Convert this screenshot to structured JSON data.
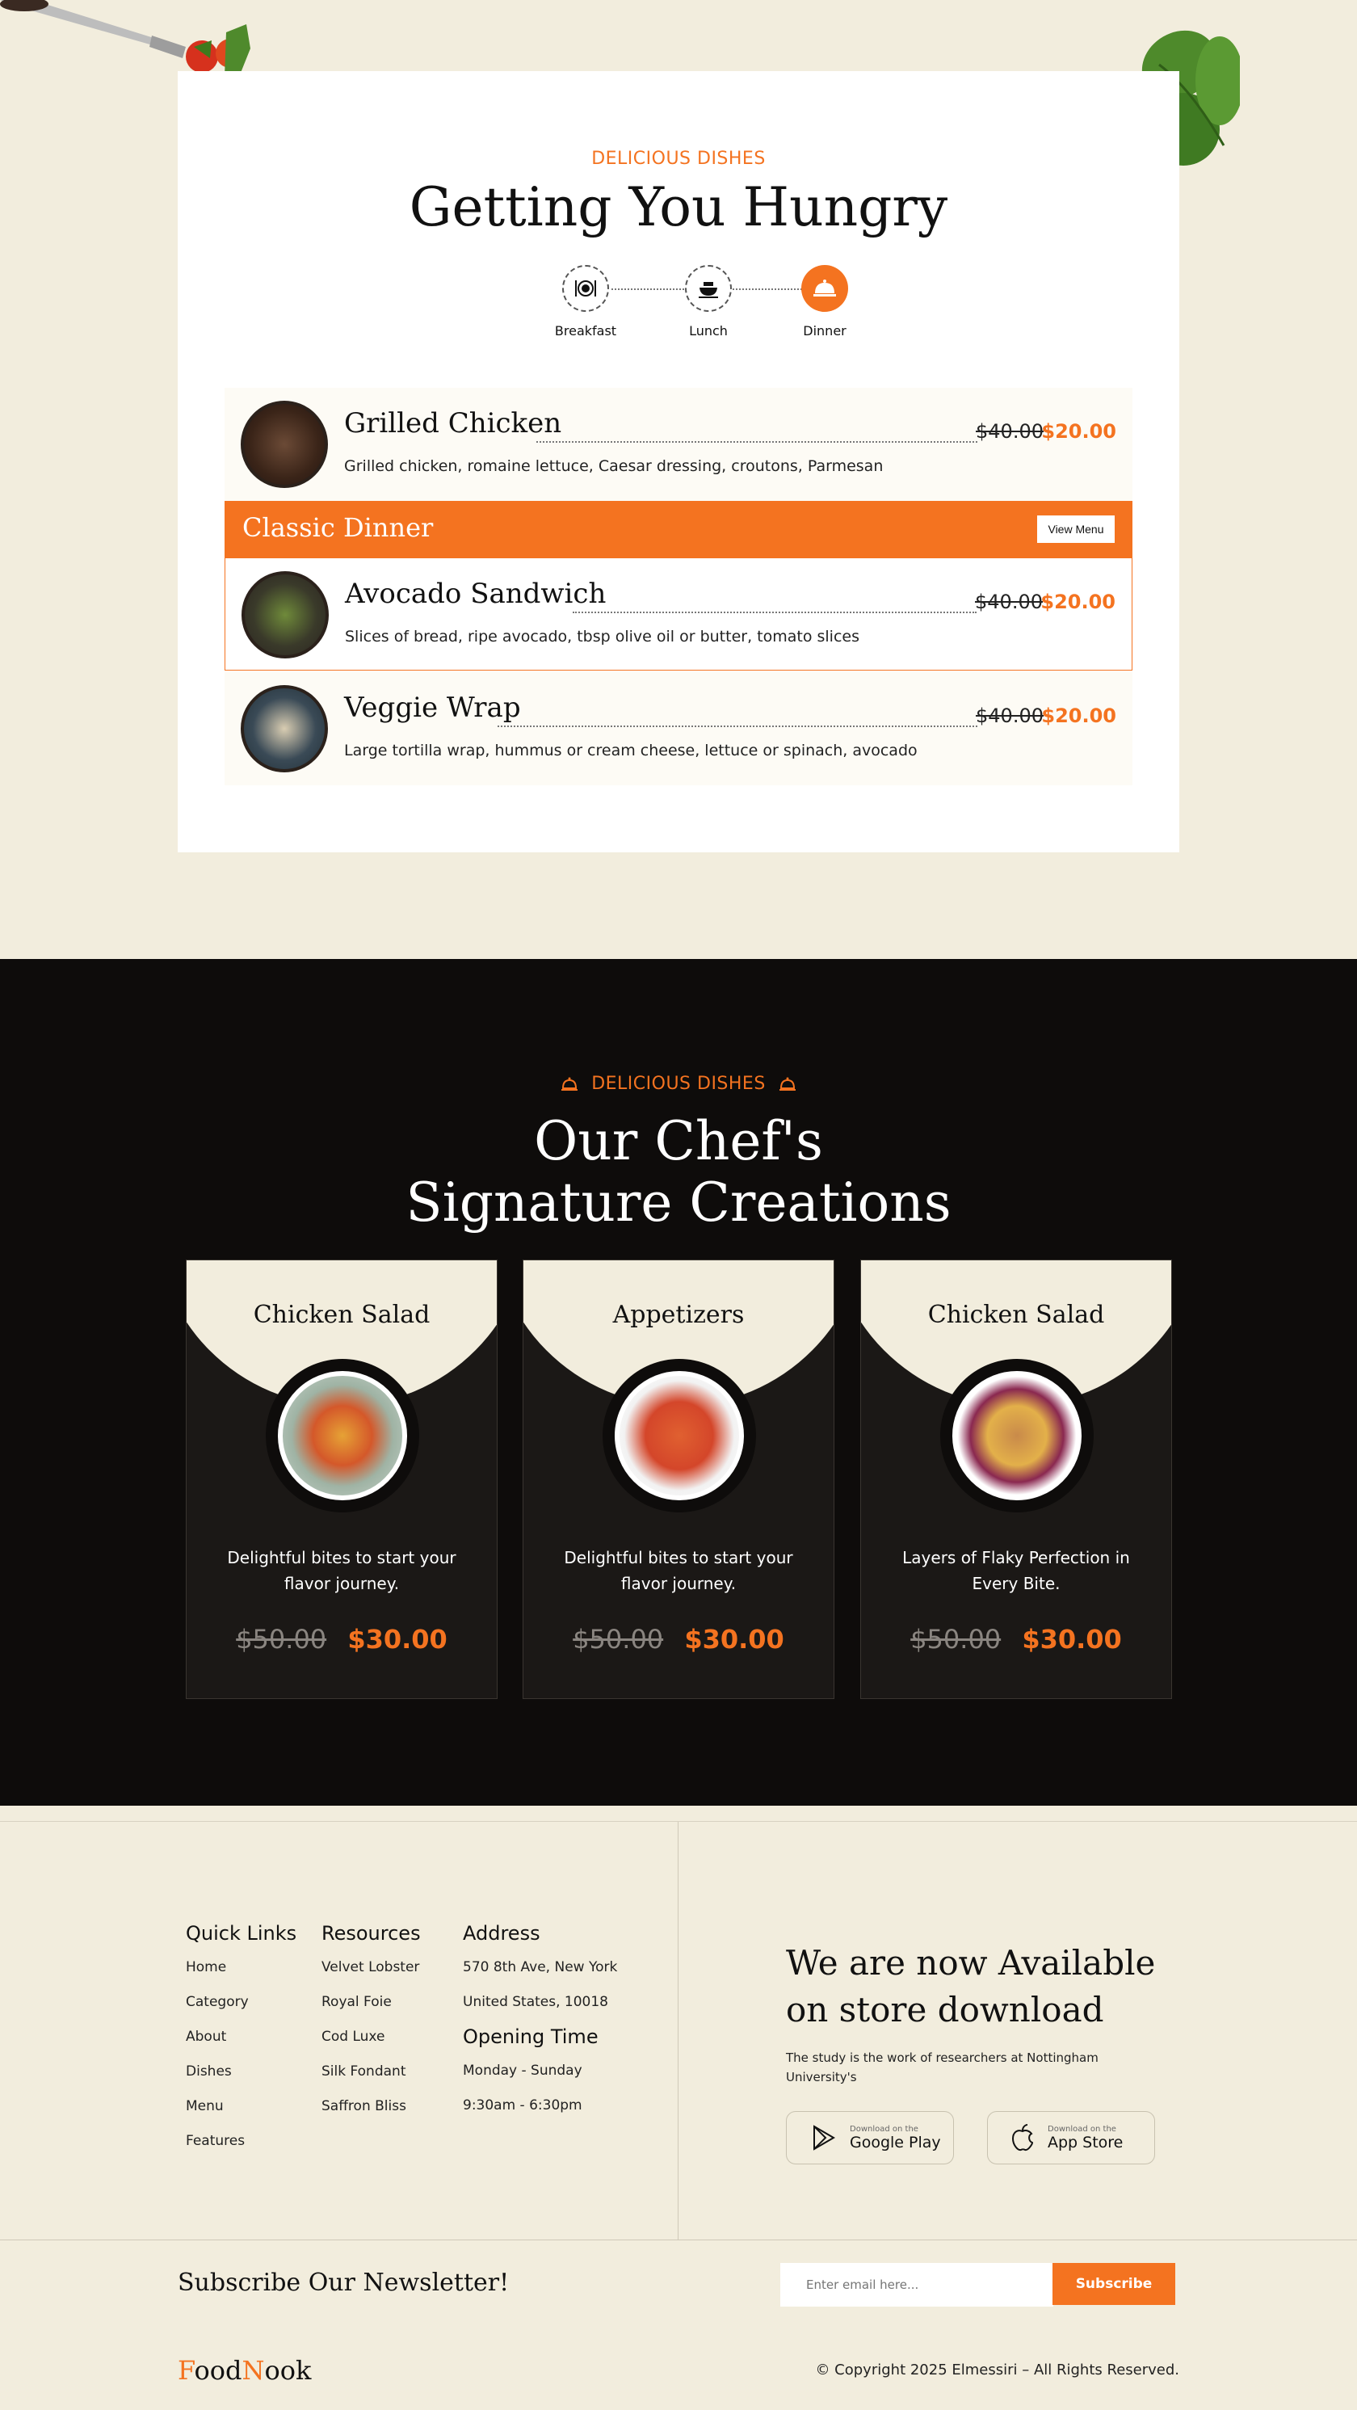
{
  "menu": {
    "eyebrow": "DELICIOUS DISHES",
    "title": "Getting You Hungry",
    "tabs": [
      {
        "label": "Breakfast",
        "icon": "plate-cutlery-icon"
      },
      {
        "label": "Lunch",
        "icon": "serving-bowl-icon"
      },
      {
        "label": "Dinner",
        "icon": "cloche-icon",
        "active": true
      }
    ],
    "dishes": [
      {
        "name": "Grilled Chicken",
        "old_price": "$40.00",
        "price": "$20.00",
        "desc": "Grilled chicken, romaine lettuce, Caesar dressing, croutons, Parmesan"
      },
      {
        "name": "Avocado Sandwich",
        "old_price": "$40.00",
        "price": "$20.00",
        "desc": "Slices of bread, ripe avocado, tbsp olive oil or butter, tomato slices"
      },
      {
        "name": "Veggie Wrap",
        "old_price": "$40.00",
        "price": "$20.00",
        "desc": "Large tortilla wrap, hummus or cream cheese, lettuce or spinach, avocado"
      }
    ],
    "banner": {
      "title": "Classic Dinner",
      "button": "View Menu"
    }
  },
  "signature": {
    "eyebrow": "DELICIOUS DISHES",
    "title_line1": "Our Chef's",
    "title_line2": "Signature Creations",
    "cards": [
      {
        "title": "Chicken Salad",
        "desc": "Delightful bites to start your flavor journey.",
        "old_price": "$50.00",
        "price": "$30.00"
      },
      {
        "title": "Appetizers",
        "desc": "Delightful bites to start your flavor journey.",
        "old_price": "$50.00",
        "price": "$30.00"
      },
      {
        "title": "Chicken Salad",
        "desc": "Layers of Flaky Perfection in Every Bite.",
        "old_price": "$50.00",
        "price": "$30.00"
      }
    ]
  },
  "footer": {
    "quick_links": {
      "heading": "Quick Links",
      "items": [
        "Home",
        "Category",
        "About",
        "Dishes",
        "Menu",
        "Features"
      ]
    },
    "resources": {
      "heading": "Resources",
      "items": [
        "Velvet Lobster",
        "Royal Foie",
        "Cod Luxe",
        "Silk Fondant",
        "Saffron Bliss"
      ]
    },
    "address": {
      "heading": "Address",
      "line1": "570 8th Ave, New York",
      "line2": "United States, 10018"
    },
    "hours": {
      "heading": "Opening Time",
      "line1": "Monday - Sunday",
      "line2": "9:30am - 6:30pm"
    },
    "available_line1": "We are now Available",
    "available_line2": "on store download",
    "available_desc": "The study is the work of researchers at Nottingham University's",
    "google": {
      "small": "Download on the",
      "big": "Google Play"
    },
    "apple": {
      "small": "Download on the",
      "big": "App Store"
    },
    "newsletter": "Subscribe Our Newsletter!",
    "email_placeholder": "Enter email here...",
    "subscribe": "Subscribe",
    "logo_f": "F",
    "logo_ood": "ood",
    "logo_n": "N",
    "logo_ook": "ook",
    "copyright": "© Copyright 2025 Elmessiri – All Rights Reserved."
  },
  "colors": {
    "accent": "#f47320",
    "cream": "#f2eddd",
    "dark": "#0e0c0b"
  }
}
